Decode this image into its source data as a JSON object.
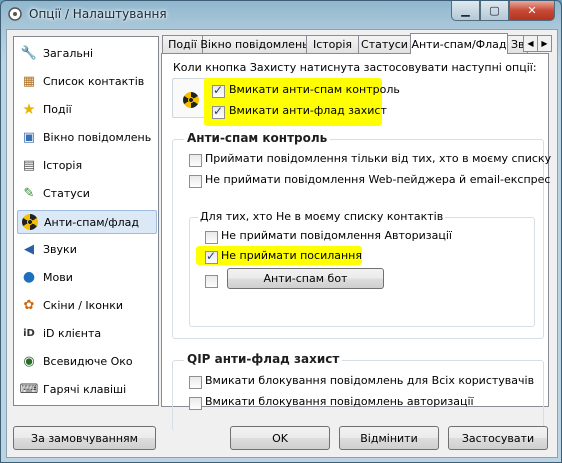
{
  "window": {
    "title": "Опції / Налаштування",
    "min_icon": "minimize-icon",
    "max_icon": "maximize-icon",
    "close_icon": "close-icon"
  },
  "sidebar": {
    "items": [
      {
        "label": "Загальні",
        "icon": "wrench-icon",
        "glyph": "🔧"
      },
      {
        "label": "Список контактів",
        "icon": "contacts-icon",
        "glyph": "📇"
      },
      {
        "label": "Події",
        "icon": "star-icon",
        "glyph": "★"
      },
      {
        "label": "Вікно повідомлень",
        "icon": "message-window-icon",
        "glyph": "▭"
      },
      {
        "label": "Історія",
        "icon": "history-icon",
        "glyph": "📄"
      },
      {
        "label": "Статуси",
        "icon": "status-icon",
        "glyph": "✎"
      },
      {
        "label": "Анти-спам/флад",
        "icon": "radiation-icon",
        "glyph": "",
        "selected": true
      },
      {
        "label": "Звуки",
        "icon": "speaker-icon",
        "glyph": "🔊"
      },
      {
        "label": "Мови",
        "icon": "globe-icon",
        "glyph": "🌐"
      },
      {
        "label": "Скіни / Іконки",
        "icon": "skins-icon",
        "glyph": "✿"
      },
      {
        "label": "iD клієнта",
        "icon": "id-icon",
        "glyph": "iD"
      },
      {
        "label": "Всевидюче Око",
        "icon": "eye-icon",
        "glyph": "◉"
      },
      {
        "label": "Гарячі клавіші",
        "icon": "hotkeys-icon",
        "glyph": "⌨"
      }
    ]
  },
  "tabs": [
    "Події",
    "Вікно повідомлень",
    "Історія",
    "Статуси",
    "Анти-спам/Флад",
    "Зв"
  ],
  "tabs_active": "Анти-спам/Флад",
  "panel": {
    "intro": "Коли кнопка Захисту натиснута застосовувати наступні опції:",
    "top_options": [
      {
        "label": "Вмикати анти-спам контроль",
        "checked": true
      },
      {
        "label": "Вмикати анти-флад захист",
        "checked": true
      }
    ],
    "antispam": {
      "title": "Анти-спам контроль",
      "options": [
        {
          "label": "Приймати повідомлення тільки від тих, хто в моєму списку",
          "checked": false
        },
        {
          "label": "Не приймати повідомлення Web-пейджера й email-експрес",
          "checked": false
        }
      ],
      "subgroup_title": "Для тих, хто Не в моєму списку контактів",
      "sub_options": [
        {
          "label": "Не приймати повідомлення Авторизації",
          "checked": false
        },
        {
          "label": "Не приймати посилання",
          "checked": true
        }
      ],
      "bot_button": "Анти-спам бот",
      "bot_checked": false
    },
    "antiflood": {
      "title": "QIP анти-флад захист",
      "options": [
        {
          "label": "Вмикати блокування повідомлень для Всіх користувачів",
          "checked": false
        },
        {
          "label": "Вмикати блокування повідомлень авторизації",
          "checked": false
        }
      ]
    }
  },
  "buttons": {
    "defaults": "За замовчуванням",
    "ok": "OK",
    "cancel": "Відмінити",
    "apply": "Застосувати"
  },
  "colors": {
    "highlight": "#ffff00",
    "selection": "#dbe8f6",
    "close": "#c74a35"
  }
}
